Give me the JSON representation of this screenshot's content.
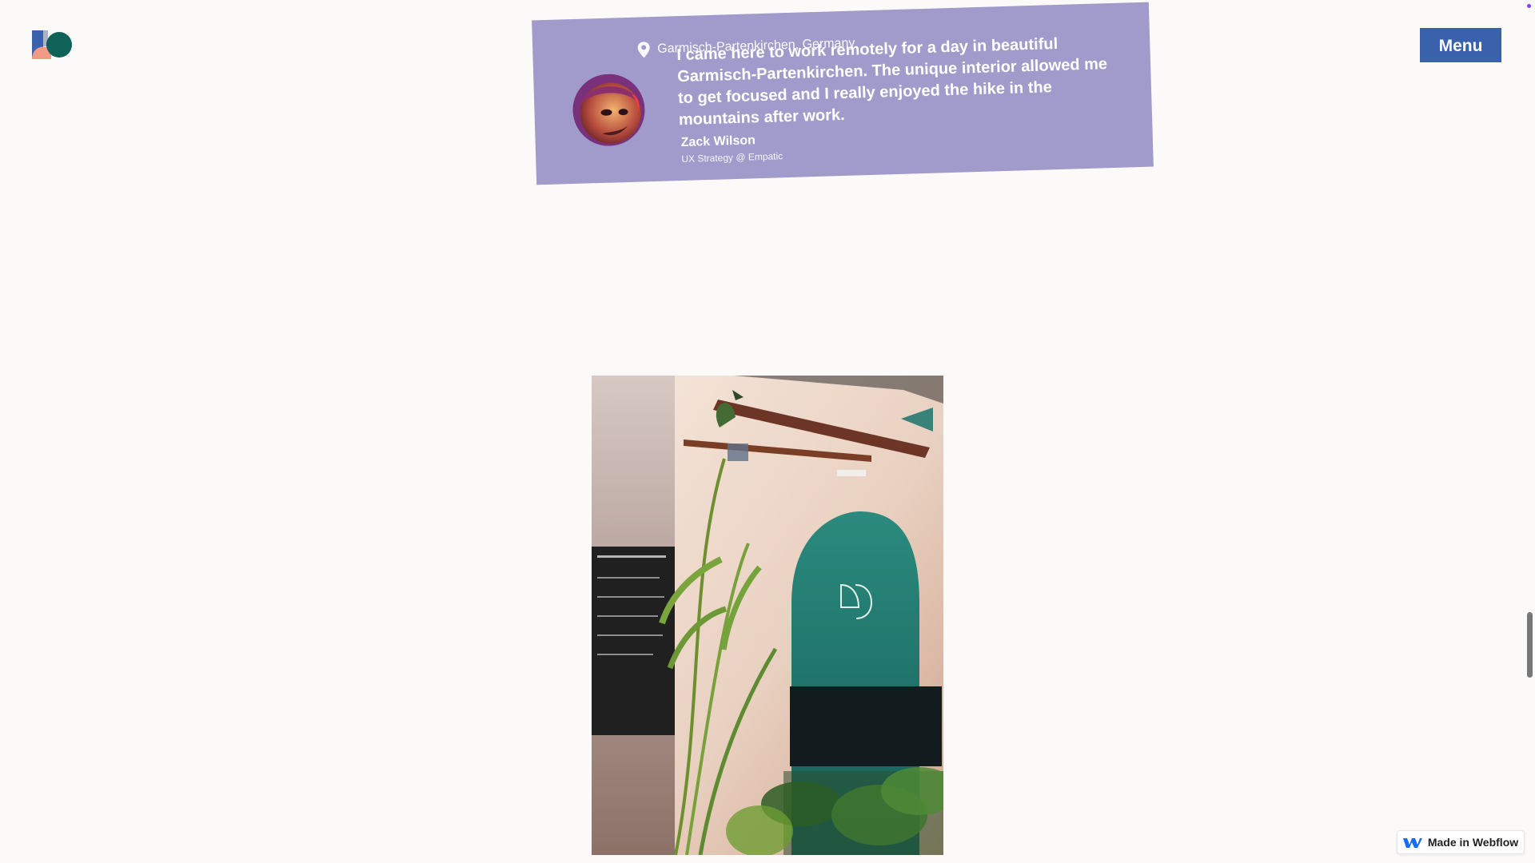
{
  "header": {
    "menu_label": "Menu",
    "logo_icon": "brand-logo-icon",
    "colors": {
      "menu_bg": "#3a62ac",
      "testimonial_bg": "#a19bcb",
      "accent_teal": "#13665e"
    }
  },
  "testimonial": {
    "location": "Garmisch-Partenkirchen, Germany",
    "quote": "I came here to work remotely for a day in beautiful Garmisch-Partenkirchen. The unique interior allowed me to get focused and I really enjoyed the hike in the mountains after work.",
    "author_name": "Zack Wilson",
    "author_role": "UX Strategy @ Empatic"
  },
  "badge": {
    "label": "Made in Webflow"
  }
}
